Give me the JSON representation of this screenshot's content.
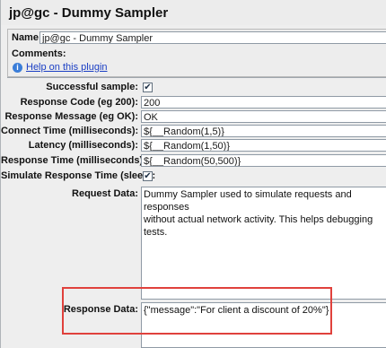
{
  "window": {
    "title": "jp@gc - Dummy Sampler"
  },
  "name_row": {
    "label": "Name:",
    "value": "jp@gc - Dummy Sampler"
  },
  "comments_row": {
    "label": "Comments:"
  },
  "help": {
    "label": "Help on this plugin",
    "icon": "info-icon"
  },
  "form": {
    "successful_sample": {
      "label": "Successful sample:",
      "checked": true
    },
    "response_code": {
      "label": "Response Code (eg 200):",
      "value": "200"
    },
    "response_message": {
      "label": "Response Message (eg OK):",
      "value": "OK"
    },
    "connect_time": {
      "label": "Connect Time (milliseconds):",
      "value": "${__Random(1,5)}"
    },
    "latency": {
      "label": "Latency (milliseconds):",
      "value": "${__Random(1,50)}"
    },
    "response_time": {
      "label": "Response Time (milliseconds):",
      "value": "${__Random(50,500)}"
    },
    "simulate_response_time": {
      "label": "Simulate Response Time (sleep):",
      "checked": true
    },
    "request_data": {
      "label": "Request Data:",
      "line1": "Dummy Sampler used to simulate requests and responses",
      "line2": "without actual network activity. This helps debugging tests."
    },
    "response_data": {
      "label": "Response Data:",
      "value": "{\"message\":\"For  client a discount of 20%\"}"
    }
  },
  "colors": {
    "highlight": "#e0413c",
    "link": "#1a3ec4"
  }
}
